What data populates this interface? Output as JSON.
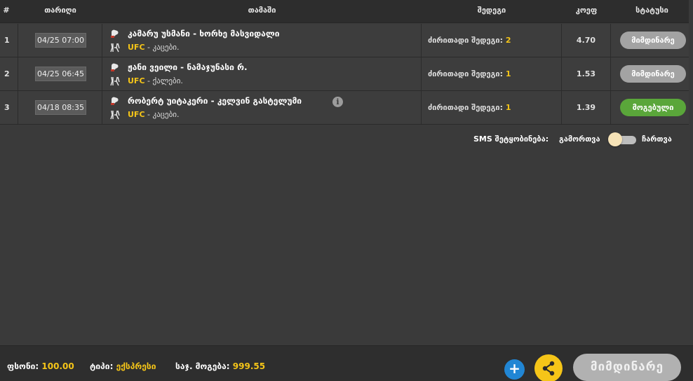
{
  "header": {
    "num": "#",
    "date": "თარიღი",
    "event": "თამაში",
    "result": "შედეგი",
    "odds": "კოეფ",
    "status": "სტატუსი"
  },
  "rows": [
    {
      "num": "1",
      "date": "04/25 07:00",
      "title": "კამარუ უსმანი - ხორხე მასვიდალი",
      "league": "UFC",
      "category": " - კაცები.",
      "result_label": "ძირითადი შედეგი: ",
      "result_value": "2",
      "odds": "4.70",
      "status": "მიმდინარე",
      "info": false
    },
    {
      "num": "2",
      "date": "04/25 06:45",
      "title": "ჟანი ვეილი - ნამაჯუნასი რ.",
      "league": "UFC",
      "category": " - ქალები.",
      "result_label": "ძირითადი შედეგი: ",
      "result_value": "1",
      "odds": "1.53",
      "status": "მიმდინარე",
      "info": false
    },
    {
      "num": "3",
      "date": "04/18 08:35",
      "title": "რობერტ უიტაკერი - კელვინ გასტელუმი",
      "league": "UFC",
      "category": " - კაცები.",
      "result_label": "ძირითადი შედეგი: ",
      "result_value": "1",
      "odds": "1.39",
      "status": "მოგებული",
      "info": true
    }
  ],
  "sms": {
    "label": "SMS შეტყობინება:",
    "off": "გამორთვა",
    "on": "ჩართვა"
  },
  "footer": {
    "stake_label": "ფსონი:",
    "stake_value": "100.00",
    "type_label": "ტიპი:",
    "type_value": "ექსპრესი",
    "win_label": "საჯ. მოგება:",
    "win_value": "999.55",
    "plus": "+",
    "current_button": "მიმდინარე"
  },
  "colors": {
    "accent": "#f5c518",
    "win": "#5aa63a",
    "pending": "#a3a3a3",
    "blue": "#2186d4"
  },
  "icons": {
    "event_icon": "boxing-glove-icon",
    "league_icon": "ufc-fighters-icon",
    "info_icon": "info-icon",
    "share_icon": "share-icon",
    "plus_icon": "plus-icon"
  }
}
